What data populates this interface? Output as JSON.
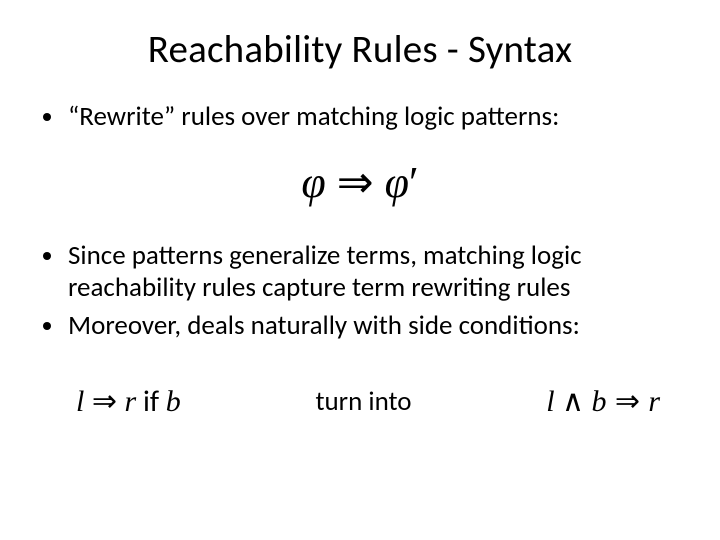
{
  "title": "Reachability Rules  -  Syntax",
  "bullets": {
    "b1": "“Rewrite” rules over matching logic patterns:",
    "b2": "Since patterns generalize terms, matching logic reachability rules capture term rewriting rules",
    "b3": "Moreover, deals naturally with side conditions:"
  },
  "formulas": {
    "main_phi": "φ",
    "main_arrow": "⇒",
    "main_phi_prime": "φ",
    "main_prime": "′",
    "left_l": "l",
    "left_arrow": "⇒",
    "left_r": "r",
    "left_if": " if ",
    "left_b": "b",
    "mid_label": "turn into",
    "right_l": "l",
    "right_and": " ∧ ",
    "right_b": "b",
    "right_arrow": " ⇒ ",
    "right_r": "r"
  }
}
